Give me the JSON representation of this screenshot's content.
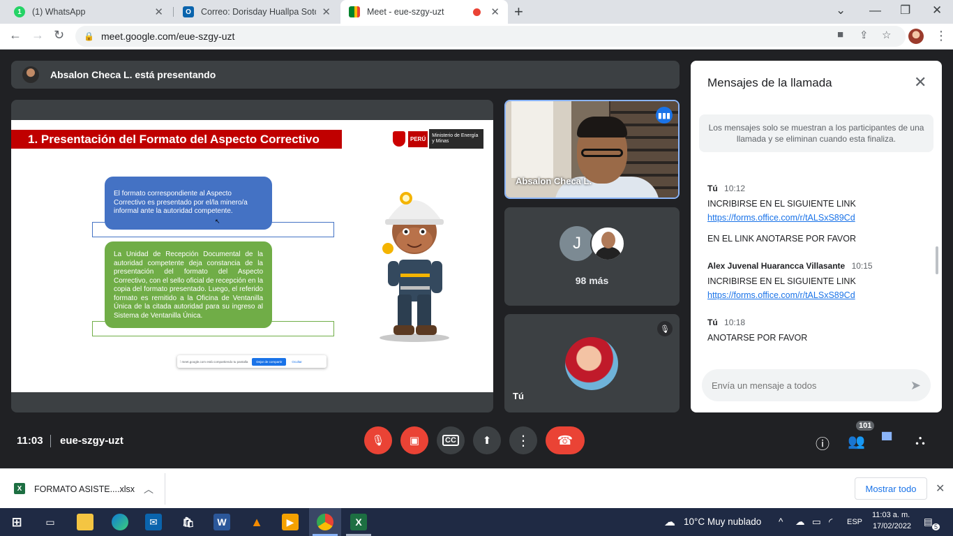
{
  "browser": {
    "tabs": [
      {
        "label": "(1) WhatsApp",
        "favicon": "1",
        "color": "#25d366"
      },
      {
        "label": "Correo: Dorisday Huallpa Soto - C",
        "favicon": "O",
        "color": "#0a64ad"
      },
      {
        "label": "Meet - eue-szgy-uzt",
        "favicon": "",
        "color": "#00832d"
      }
    ],
    "url": "meet.google.com/eue-szgy-uzt"
  },
  "meet": {
    "presenter_banner": "Absalon Checa L. está presentando",
    "slide": {
      "title": "1. Presentación del Formato del Aspecto  Correctivo",
      "logo_peru": "PERÚ",
      "logo_ministry": "Ministerio de Energía y Minas",
      "box_blue": "El formato correspondiente al Aspecto Correctivo es presentado por el/la minero/a informal ante la autoridad competente.",
      "box_green": "La Unidad de Recepción Documental de la autoridad competente deja constancia de la presentación del formato del Aspecto Correctivo, con el sello oficial de recepción en la copia del formato presentado. Luego, el referido formato es remitido a la Oficina de Ventanilla Única de la citada autoridad para su ingreso al Sistema de Ventanilla Única.",
      "share_text": "meet.google.com está compartiendo tu pantalla",
      "share_stop": "Dejar de compartir",
      "share_hide": "Ocultar"
    },
    "tiles": {
      "presenter_name": "Absalon Checa L.",
      "avatar_letter": "J",
      "more_label": "98 más",
      "self_label": "Tú"
    },
    "chat": {
      "title": "Mensajes de la llamada",
      "notice": "Los mensajes solo se muestran a los participantes de una llamada y se eliminan cuando esta finaliza.",
      "messages": [
        {
          "who": "Tú",
          "time": "10:12",
          "lines": [
            "INCRIBIRSE EN EL SIGUIENTE LINK"
          ],
          "link": "https://forms.office.com/r/tALSxS89Cd",
          "extra": "EN EL LINK ANOTARSE POR FAVOR"
        },
        {
          "who": "Alex Juvenal Huarancca Villasante",
          "time": "10:15",
          "lines": [
            "INCRIBIRSE EN EL SIGUIENTE LINK"
          ],
          "link": "https://forms.office.com/r/tALSxS89Cd"
        },
        {
          "who": "Tú",
          "time": "10:18",
          "lines": [
            "ANOTARSE POR FAVOR"
          ]
        }
      ],
      "input_placeholder": "Envía un mensaje a todos"
    },
    "controls": {
      "time": "11:03",
      "meeting_code": "eue-szgy-uzt",
      "participants_count": "101"
    }
  },
  "download": {
    "filename": "FORMATO  ASISTE....xlsx",
    "show_all": "Mostrar todo"
  },
  "taskbar": {
    "weather": "10°C  Muy nublado",
    "lang": "ESP",
    "time": "11:03 a. m.",
    "date": "17/02/2022",
    "notifications": "5"
  }
}
